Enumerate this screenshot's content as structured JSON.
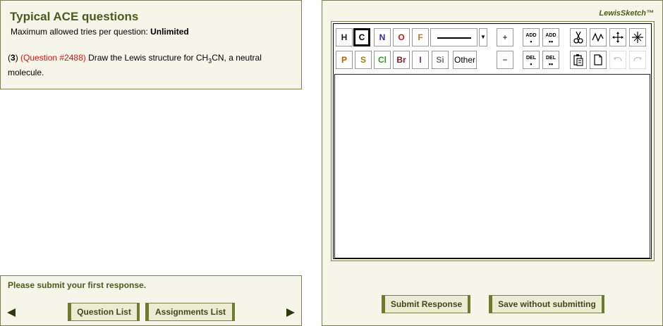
{
  "question_panel": {
    "title": "Typical ACE questions",
    "tries_label": "Maximum allowed tries per question:",
    "tries_value": "Unlimited",
    "number": "3",
    "ref": "(Question #2488)",
    "text_before": "Draw the Lewis structure for CH",
    "subscript": "3",
    "text_after": "CN, a neutral molecule."
  },
  "status_panel": {
    "message": "Please submit your first response.",
    "question_list_label": "Question List",
    "assignments_list_label": "Assignments List"
  },
  "editor": {
    "brand": "LewisSketch™",
    "selected_element": "C",
    "elements_row1": [
      {
        "symbol": "H",
        "color": "#1a1a1a"
      },
      {
        "symbol": "C",
        "color": "#000000"
      },
      {
        "symbol": "N",
        "color": "#2b2bb0"
      },
      {
        "symbol": "O",
        "color": "#e01010"
      },
      {
        "symbol": "F",
        "color": "#b08020"
      }
    ],
    "elements_row2": [
      {
        "symbol": "P",
        "color": "#b06000"
      },
      {
        "symbol": "S",
        "color": "#a08000"
      },
      {
        "symbol": "Cl",
        "color": "#20a020"
      },
      {
        "symbol": "Br",
        "color": "#7a2020"
      },
      {
        "symbol": "I",
        "color": "#8a20a0"
      },
      {
        "symbol": "Si",
        "color": "#707070"
      }
    ],
    "other_label": "Other",
    "plus_label": "+",
    "minus_label": "−",
    "add_label": "ADD",
    "del_label": "DEL",
    "tools": [
      "scissors-icon",
      "wave-icon",
      "move-icon",
      "crosshair-icon",
      "clipboard-icon",
      "new-page-icon",
      "undo-icon",
      "redo-icon"
    ]
  },
  "actions": {
    "submit_label": "Submit Response",
    "save_label": "Save without submitting"
  }
}
